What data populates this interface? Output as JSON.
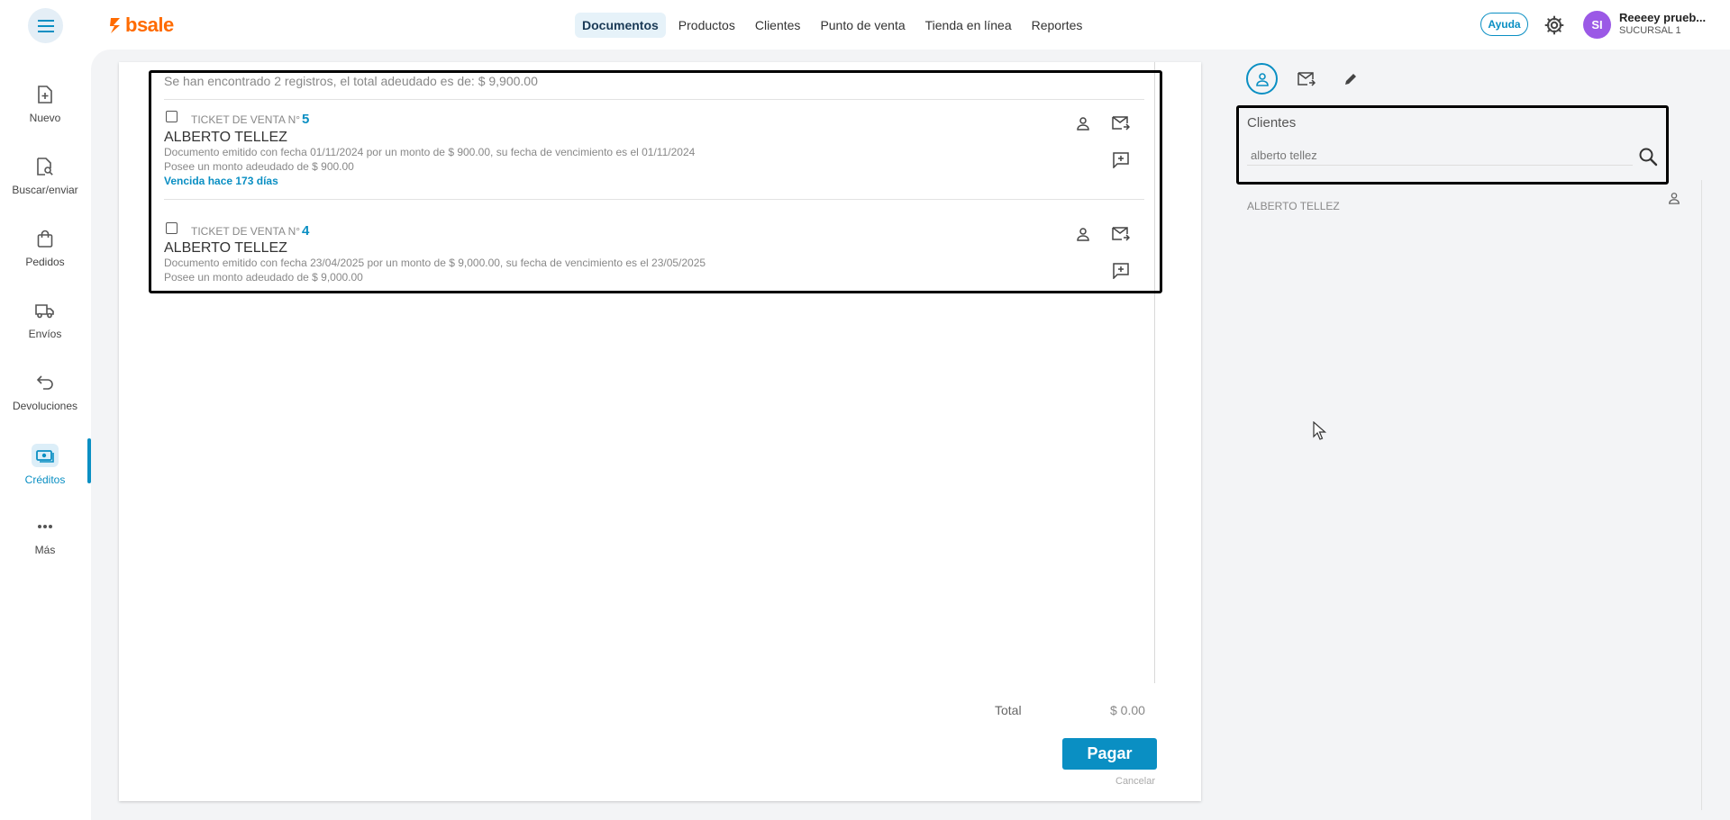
{
  "app": {
    "logo_text": "bsale",
    "brand_color": "#ff6b00",
    "accent_color": "#0a8fc3"
  },
  "nav": {
    "items": [
      {
        "label": "Documentos"
      },
      {
        "label": "Productos"
      },
      {
        "label": "Clientes"
      },
      {
        "label": "Punto de venta"
      },
      {
        "label": "Tienda en línea"
      },
      {
        "label": "Reportes"
      }
    ],
    "active": "Documentos"
  },
  "header": {
    "help_label": "Ayuda",
    "avatar_initials": "SI",
    "user_name": "Reeeey prueb...",
    "branch": "SUCURSAL 1"
  },
  "sidebar": {
    "items": [
      {
        "label": "Nuevo",
        "icon": "file-plus-icon"
      },
      {
        "label": "Buscar/enviar",
        "icon": "file-search-icon"
      },
      {
        "label": "Pedidos",
        "icon": "shopping-bag-icon"
      },
      {
        "label": "Envíos",
        "icon": "truck-icon"
      },
      {
        "label": "Devoluciones",
        "icon": "return-arrow-icon"
      },
      {
        "label": "Créditos",
        "icon": "credit-money-icon"
      },
      {
        "label": "Más",
        "icon": "more-dots-icon"
      }
    ],
    "active": "Créditos"
  },
  "main": {
    "summary": "Se han encontrado 2 registros, el total adeudado es de: $ 9,900.00",
    "documents": [
      {
        "type": "TICKET DE VENTA N°",
        "number": "5",
        "client": "ALBERTO TELLEZ",
        "detail": "Documento emitido con fecha 01/11/2024 por un monto de $ 900.00, su fecha de vencimiento es el 01/11/2024",
        "owed": "Posee un monto adeudado de $ 900.00",
        "due_status": "Vencida hace 173 días"
      },
      {
        "type": "TICKET DE VENTA N°",
        "number": "4",
        "client": "ALBERTO TELLEZ",
        "detail": "Documento emitido con fecha 23/04/2025 por un monto de $ 9,000.00, su fecha de vencimiento es el 23/05/2025",
        "owed": "Posee un monto adeudado de $ 9,000.00",
        "due_status": ""
      }
    ],
    "total_label": "Total",
    "total_value": "$ 0.00",
    "pay_label": "Pagar",
    "cancel_label": "Cancelar"
  },
  "right_panel": {
    "tabs": [
      "person-icon",
      "mail-forward-icon",
      "pencil-icon"
    ],
    "clients_title": "Clientes",
    "search_value": "alberto tellez",
    "results": [
      {
        "name": "ALBERTO TELLEZ"
      }
    ]
  }
}
